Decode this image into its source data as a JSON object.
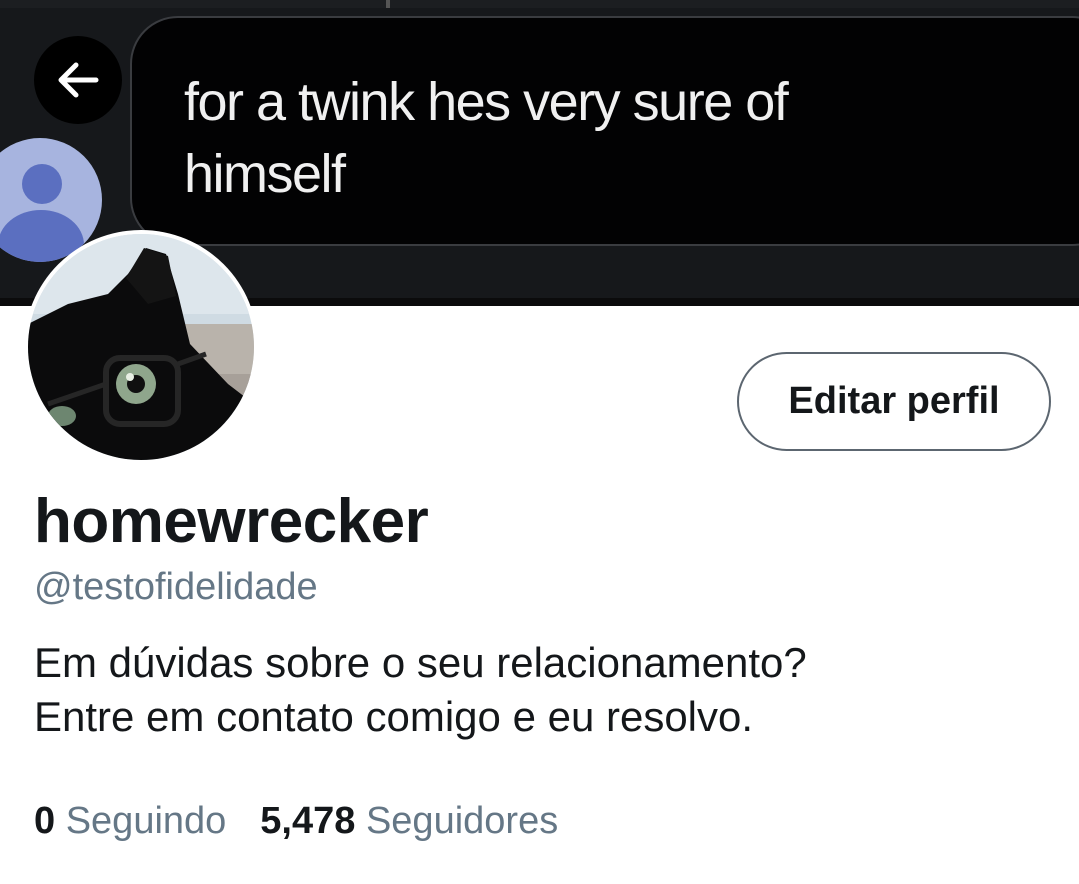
{
  "header": {
    "back_icon": "arrow-left-icon",
    "banner_tweet": {
      "avatar_icon": "default-user-avatar-icon",
      "lines": [
        "for a twink hes very sure of",
        "himself"
      ]
    }
  },
  "profile": {
    "avatar_description": "black-cat-with-glasses",
    "edit_button_label": "Editar perfil",
    "display_name": "homewrecker",
    "handle": "@testofidelidade",
    "bio_lines": [
      "Em dúvidas sobre o seu relacionamento?",
      "Entre em contato comigo e eu resolvo."
    ]
  },
  "stats": {
    "following_count": "0",
    "following_label": "Seguindo",
    "followers_count": "5,478",
    "followers_label": "Seguidores"
  },
  "colors": {
    "text_primary": "#14171a",
    "text_secondary": "#657786",
    "banner_bg": "#16181b"
  }
}
